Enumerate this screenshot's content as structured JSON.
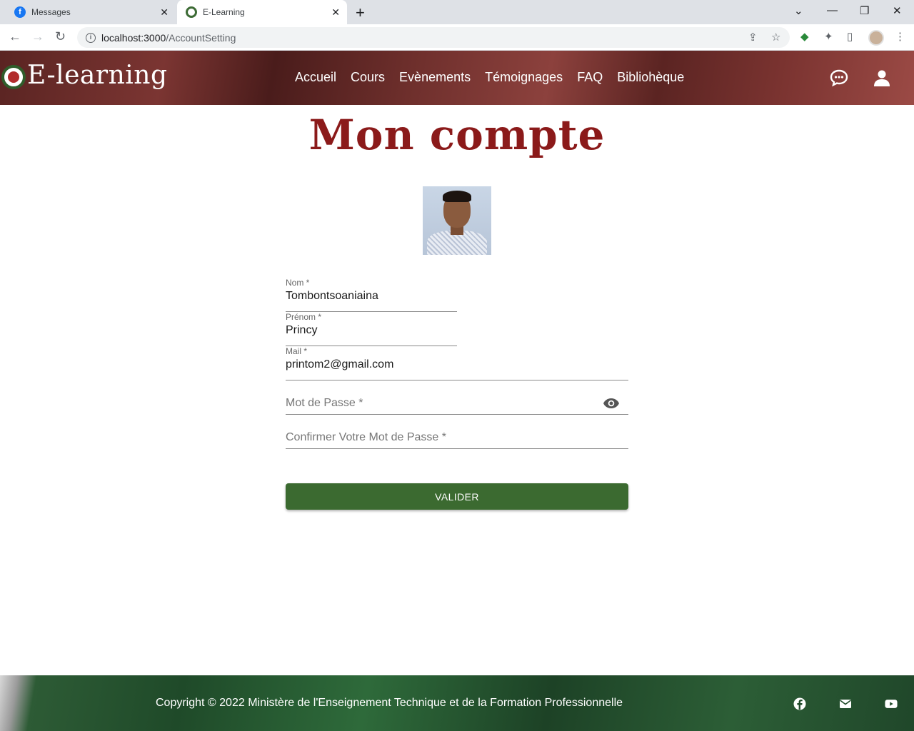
{
  "browser": {
    "tabs": [
      {
        "title": "Messages",
        "favicon": "facebook-icon"
      },
      {
        "title": "E-Learning",
        "favicon": "elearning-logo-icon"
      }
    ],
    "url_host": "localhost:3000",
    "url_path": "/AccountSetting"
  },
  "header": {
    "logo_text": "E-learning",
    "nav": [
      "Accueil",
      "Cours",
      "Evènements",
      "Témoignages",
      "FAQ",
      "Bibliohèque"
    ],
    "icons": [
      "chat-icon",
      "user-icon"
    ]
  },
  "main": {
    "title": "Mon compte",
    "form": {
      "nom_label": "Nom *",
      "nom_value": "Tombontsoaniaina",
      "prenom_label": "Prénom *",
      "prenom_value": "Princy",
      "mail_label": "Mail *",
      "mail_value": "printom2@gmail.com",
      "password_placeholder": "Mot de Passe *",
      "confirm_placeholder": "Confirmer Votre Mot de Passe *",
      "submit_label": "VALIDER"
    }
  },
  "footer": {
    "copyright": "Copyright © 2022 Ministère de l'Enseignement Technique et de la Formation Professionnelle",
    "icons": [
      "facebook-icon",
      "mail-icon",
      "youtube-icon"
    ]
  },
  "colors": {
    "header": "#6e2f2c",
    "title": "#8b1a1a",
    "button": "#3b6a30",
    "footer": "#1f4a29"
  }
}
